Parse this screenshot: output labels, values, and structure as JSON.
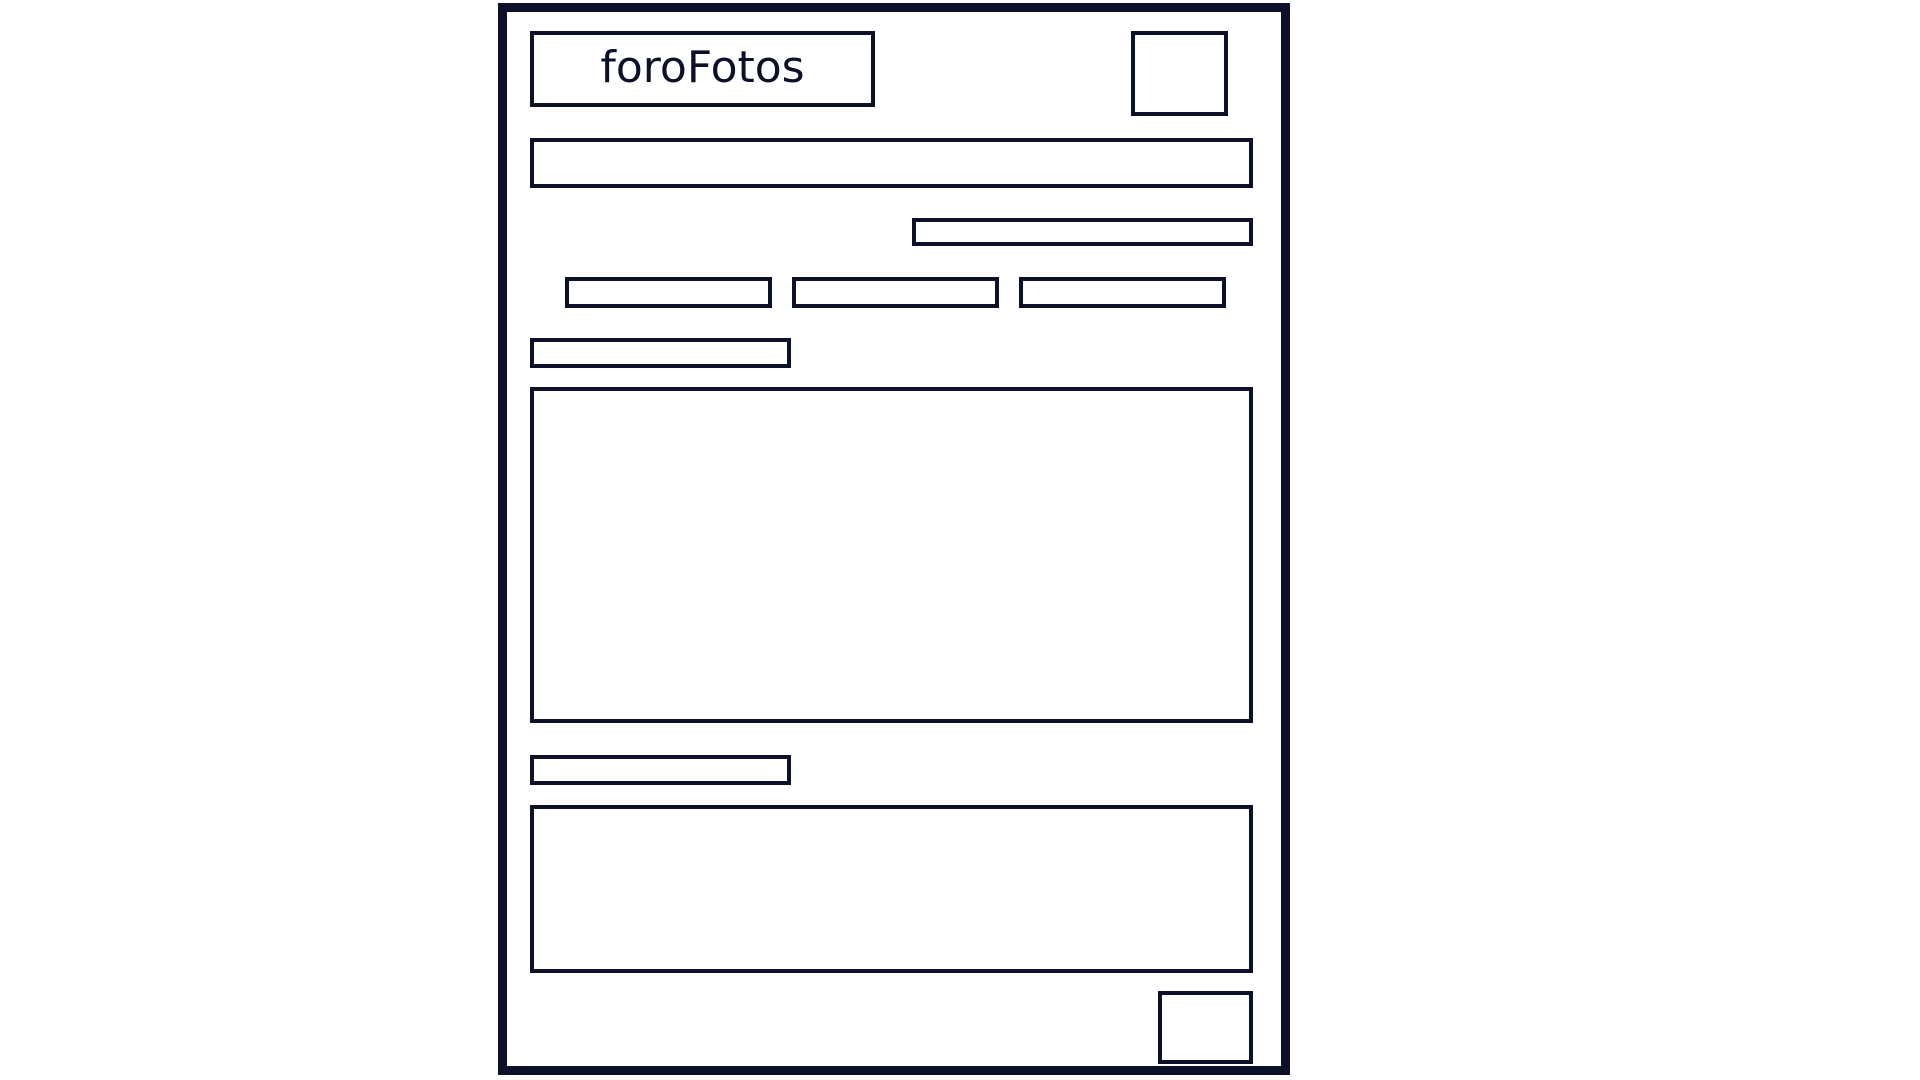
{
  "header": {
    "logo_text": "foroFotos"
  },
  "colors": {
    "ink": "#0c1029",
    "background": "#ffffff"
  }
}
